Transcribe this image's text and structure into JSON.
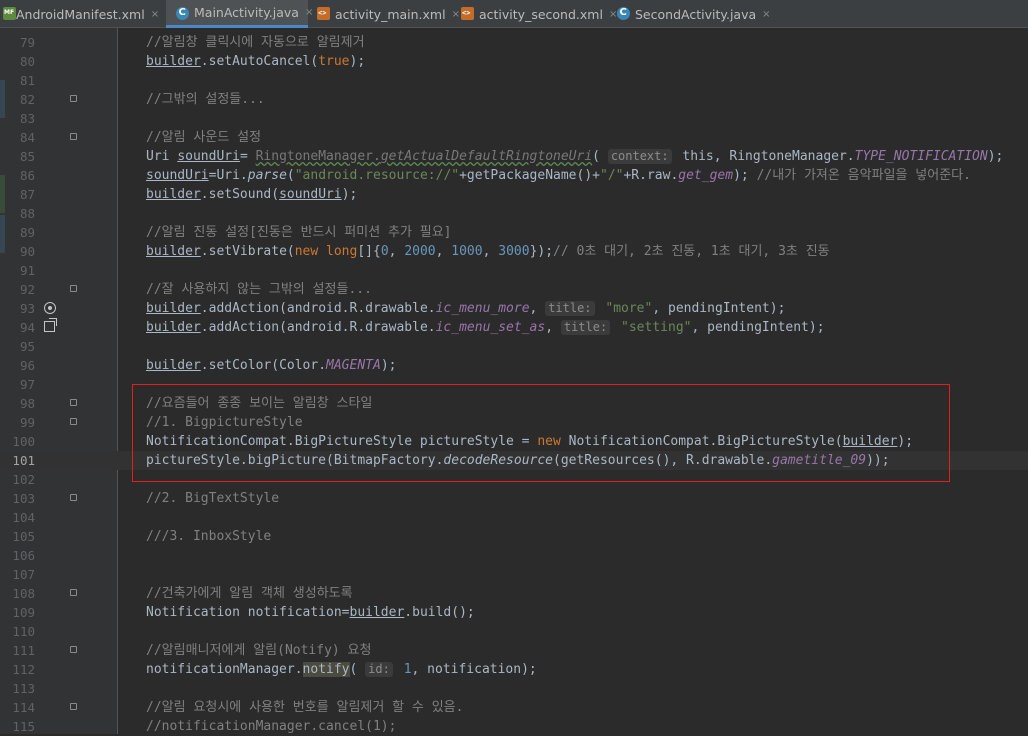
{
  "tabs": [
    {
      "label": "AndroidManifest.xml",
      "icon": "manifest-icon",
      "active": false
    },
    {
      "label": "MainActivity.java",
      "icon": "java-class-icon",
      "active": true
    },
    {
      "label": "activity_main.xml",
      "icon": "xml-layout-icon",
      "active": false
    },
    {
      "label": "activity_second.xml",
      "icon": "xml-layout-icon",
      "active": false
    },
    {
      "label": "SecondActivity.java",
      "icon": "java-class-icon",
      "active": false
    }
  ],
  "close_glyph": "×",
  "lines": {
    "79": "//알림창 클릭시에 자동으로 알림제거",
    "82": "//그밖의 설정들...",
    "84": "//알림 사운드 설정",
    "89": "//알림 진동 설정[진동은 반드시 퍼미션 추가 필요]",
    "92": "//잘 사용하지 않는 그밖의 설정들...",
    "98": "//요즘들어 종종 보이는 알림창 스타일",
    "99": "//1. BigpictureStyle",
    "103": "//2. BigTextStyle",
    "105": "///3. InboxStyle",
    "108": "//건축가에게 알림 객체 생성하도록",
    "111": "//알림매니저에게 알림(Notify) 요청",
    "114": "//알림 요청시에 사용한 번호를 알림제거 할 수 있음.",
    "115": "//notificationManager.cancel(1);"
  },
  "code": {
    "l80": [
      "builder",
      ".setAutoCancel(",
      "true",
      ");"
    ],
    "l85": [
      "Uri ",
      "soundUri",
      "= ",
      "RingtoneManager.",
      "getActualDefaultRingtoneUri",
      "( ",
      "context:",
      " this, RingtoneManager.",
      "TYPE_NOTIFICATION",
      ");"
    ],
    "l86": [
      "soundUri",
      "=Uri.",
      "parse",
      "(",
      "\"android.resource://\"",
      "+getPackageName()+",
      "\"/\"",
      "+R.raw.",
      "get_gem",
      "); ",
      "//내가 가져온 음악파일을 넣어준다."
    ],
    "l87": [
      "builder",
      ".setSound(",
      "soundUri",
      ");"
    ],
    "l90": [
      "builder",
      ".setVibrate(",
      "new long",
      "[]{",
      "0",
      ", ",
      "2000",
      ", ",
      "1000",
      ", ",
      "3000",
      "});",
      "// 0초 대기, 2초 진동, 1초 대기, 3초 진동"
    ],
    "l93": [
      "builder",
      ".addAction(android.R.drawable.",
      "ic_menu_more",
      ", ",
      "title:",
      " ",
      "\"more\"",
      ", pendingIntent);"
    ],
    "l94": [
      "builder",
      ".addAction(android.R.drawable.",
      "ic_menu_set_as",
      ", ",
      "title:",
      " ",
      "\"setting\"",
      ", pendingIntent);"
    ],
    "l96": [
      "builder",
      ".setColor(Color.",
      "MAGENTA",
      ");"
    ],
    "l100": [
      "NotificationCompat.BigPictureStyle pictureStyle = ",
      "new",
      " NotificationCompat.BigPictureStyle(",
      "builder",
      ");"
    ],
    "l101": [
      "pictureStyle.bigPicture(BitmapFactory.",
      "decodeResource",
      "(getResources(), R.drawable.",
      "gametitle_09",
      "));"
    ],
    "l109": [
      "Notification notification=",
      "builder",
      ".build();"
    ],
    "l112": [
      "notificationManager.",
      "notify",
      "( ",
      "id:",
      " ",
      "1",
      ", notification);"
    ]
  },
  "line_numbers": [
    "79",
    "80",
    "81",
    "82",
    "83",
    "84",
    "85",
    "86",
    "87",
    "88",
    "89",
    "90",
    "91",
    "92",
    "93",
    "94",
    "95",
    "96",
    "97",
    "98",
    "99",
    "100",
    "101",
    "102",
    "103",
    "104",
    "105",
    "106",
    "107",
    "108",
    "109",
    "110",
    "111",
    "112",
    "113",
    "114",
    "115"
  ],
  "current_line": "101",
  "colors": {
    "keyword": "#cc7832",
    "string": "#6a8759",
    "number": "#6897bb",
    "comment": "#808080",
    "static_field": "#9876aa",
    "highlight_box": "#e21f1f"
  }
}
